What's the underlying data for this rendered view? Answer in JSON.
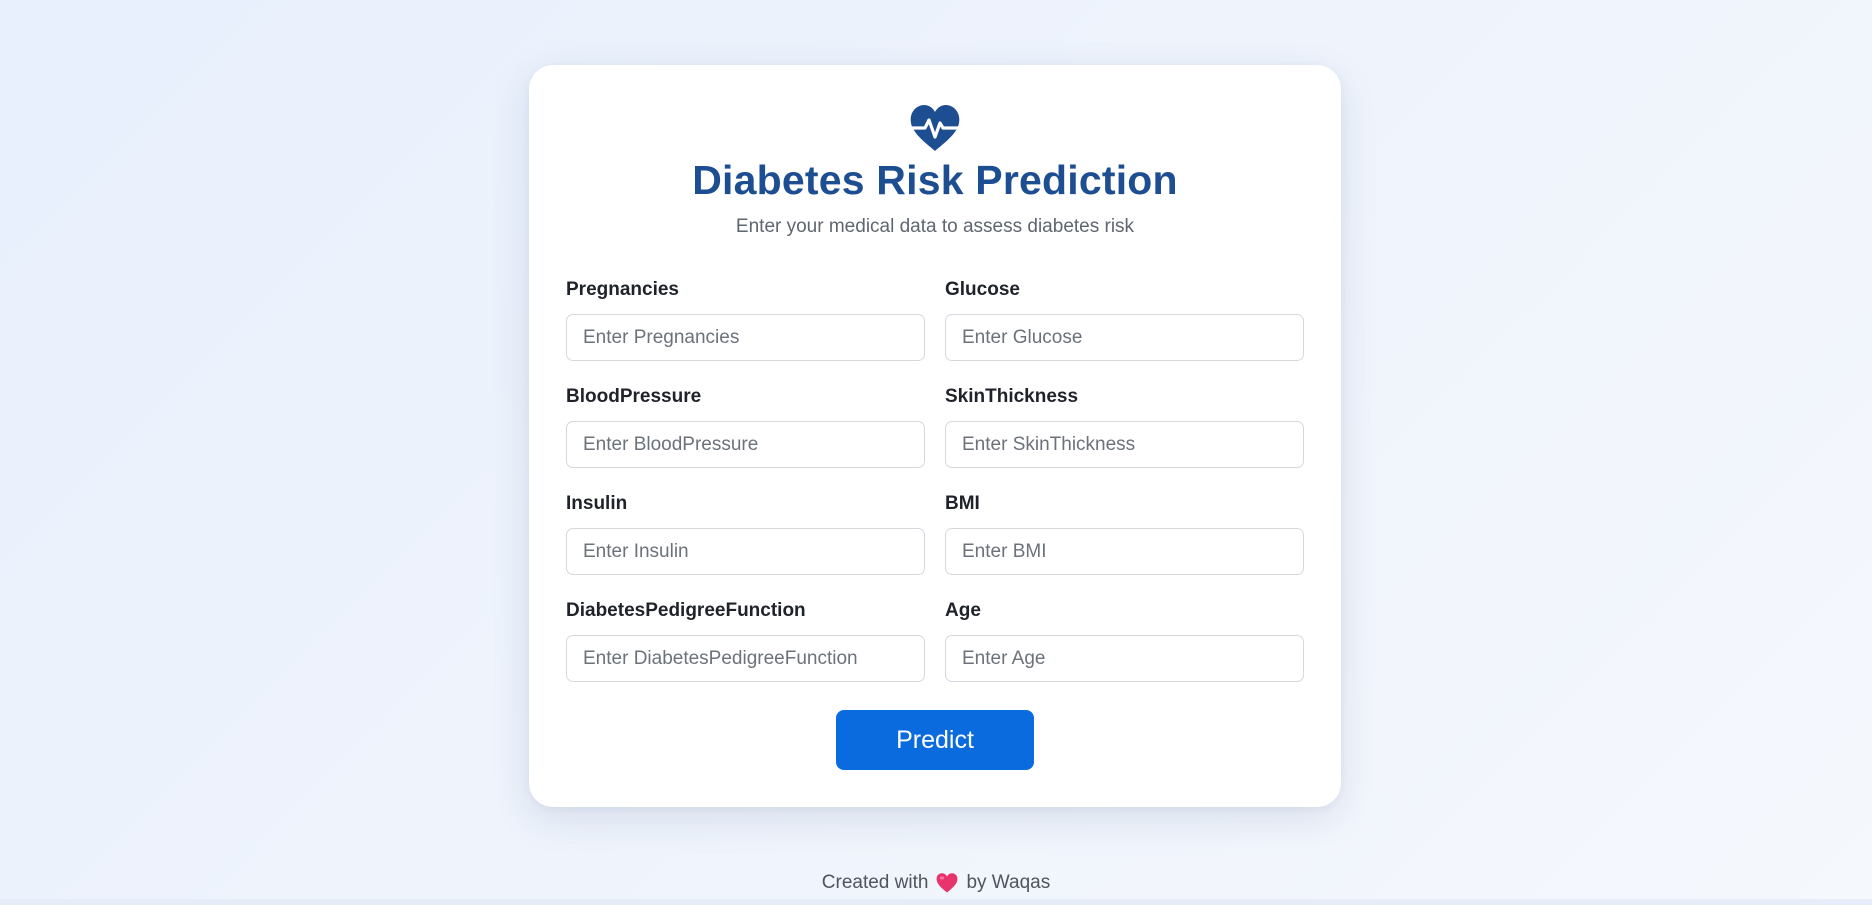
{
  "header": {
    "title": "Diabetes Risk Prediction",
    "subtitle": "Enter your medical data to assess diabetes risk",
    "logo_icon": "heartbeat-icon"
  },
  "form": {
    "fields": [
      {
        "label": "Pregnancies",
        "placeholder": "Enter Pregnancies",
        "value": ""
      },
      {
        "label": "Glucose",
        "placeholder": "Enter Glucose",
        "value": ""
      },
      {
        "label": "BloodPressure",
        "placeholder": "Enter BloodPressure",
        "value": ""
      },
      {
        "label": "SkinThickness",
        "placeholder": "Enter SkinThickness",
        "value": ""
      },
      {
        "label": "Insulin",
        "placeholder": "Enter Insulin",
        "value": ""
      },
      {
        "label": "BMI",
        "placeholder": "Enter BMI",
        "value": ""
      },
      {
        "label": "DiabetesPedigreeFunction",
        "placeholder": "Enter DiabetesPedigreeFunction",
        "value": ""
      },
      {
        "label": "Age",
        "placeholder": "Enter Age",
        "value": ""
      }
    ],
    "submit_label": "Predict"
  },
  "footer": {
    "prefix": "Created with",
    "icon": "heart-icon",
    "suffix": "by Waqas"
  },
  "colors": {
    "accent": "#0a6bdf",
    "title": "#1e4e92",
    "heart": "#e8336d"
  }
}
